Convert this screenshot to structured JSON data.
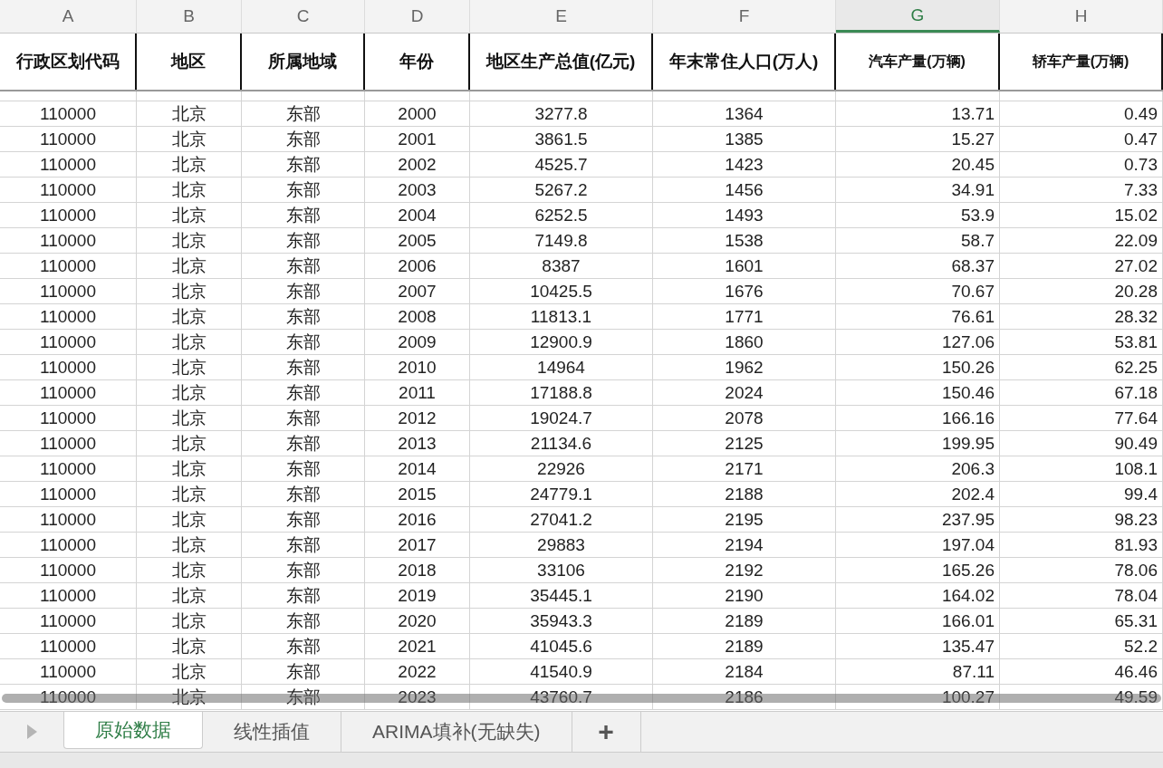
{
  "column_letters": [
    {
      "label": "A",
      "selected": false
    },
    {
      "label": "B",
      "selected": false
    },
    {
      "label": "C",
      "selected": false
    },
    {
      "label": "D",
      "selected": false
    },
    {
      "label": "E",
      "selected": false
    },
    {
      "label": "F",
      "selected": false
    },
    {
      "label": "G",
      "selected": true
    },
    {
      "label": "H",
      "selected": false
    }
  ],
  "table": {
    "columns": [
      "行政区划代码",
      "地区",
      "所属地域",
      "年份",
      "地区生产总值(亿元)",
      "年末常住人口(万人)",
      "汽车产量(万辆)",
      "轿车产量(万辆)"
    ],
    "rows": [
      [
        "110000",
        "北京",
        "东部",
        "2000",
        "3277.8",
        "1364",
        "13.71",
        "0.49"
      ],
      [
        "110000",
        "北京",
        "东部",
        "2001",
        "3861.5",
        "1385",
        "15.27",
        "0.47"
      ],
      [
        "110000",
        "北京",
        "东部",
        "2002",
        "4525.7",
        "1423",
        "20.45",
        "0.73"
      ],
      [
        "110000",
        "北京",
        "东部",
        "2003",
        "5267.2",
        "1456",
        "34.91",
        "7.33"
      ],
      [
        "110000",
        "北京",
        "东部",
        "2004",
        "6252.5",
        "1493",
        "53.9",
        "15.02"
      ],
      [
        "110000",
        "北京",
        "东部",
        "2005",
        "7149.8",
        "1538",
        "58.7",
        "22.09"
      ],
      [
        "110000",
        "北京",
        "东部",
        "2006",
        "8387",
        "1601",
        "68.37",
        "27.02"
      ],
      [
        "110000",
        "北京",
        "东部",
        "2007",
        "10425.5",
        "1676",
        "70.67",
        "20.28"
      ],
      [
        "110000",
        "北京",
        "东部",
        "2008",
        "11813.1",
        "1771",
        "76.61",
        "28.32"
      ],
      [
        "110000",
        "北京",
        "东部",
        "2009",
        "12900.9",
        "1860",
        "127.06",
        "53.81"
      ],
      [
        "110000",
        "北京",
        "东部",
        "2010",
        "14964",
        "1962",
        "150.26",
        "62.25"
      ],
      [
        "110000",
        "北京",
        "东部",
        "2011",
        "17188.8",
        "2024",
        "150.46",
        "67.18"
      ],
      [
        "110000",
        "北京",
        "东部",
        "2012",
        "19024.7",
        "2078",
        "166.16",
        "77.64"
      ],
      [
        "110000",
        "北京",
        "东部",
        "2013",
        "21134.6",
        "2125",
        "199.95",
        "90.49"
      ],
      [
        "110000",
        "北京",
        "东部",
        "2014",
        "22926",
        "2171",
        "206.3",
        "108.1"
      ],
      [
        "110000",
        "北京",
        "东部",
        "2015",
        "24779.1",
        "2188",
        "202.4",
        "99.4"
      ],
      [
        "110000",
        "北京",
        "东部",
        "2016",
        "27041.2",
        "2195",
        "237.95",
        "98.23"
      ],
      [
        "110000",
        "北京",
        "东部",
        "2017",
        "29883",
        "2194",
        "197.04",
        "81.93"
      ],
      [
        "110000",
        "北京",
        "东部",
        "2018",
        "33106",
        "2192",
        "165.26",
        "78.06"
      ],
      [
        "110000",
        "北京",
        "东部",
        "2019",
        "35445.1",
        "2190",
        "164.02",
        "78.04"
      ],
      [
        "110000",
        "北京",
        "东部",
        "2020",
        "35943.3",
        "2189",
        "166.01",
        "65.31"
      ],
      [
        "110000",
        "北京",
        "东部",
        "2021",
        "41045.6",
        "2189",
        "135.47",
        "52.2"
      ],
      [
        "110000",
        "北京",
        "东部",
        "2022",
        "41540.9",
        "2184",
        "87.11",
        "46.46"
      ],
      [
        "110000",
        "北京",
        "东部",
        "2023",
        "43760.7",
        "2186",
        "100.27",
        "49.59"
      ]
    ]
  },
  "sheet_tabs": [
    {
      "label": "原始数据",
      "selected": true
    },
    {
      "label": "线性插值",
      "selected": false
    },
    {
      "label": "ARIMA填补(无缺失)",
      "selected": false
    }
  ],
  "add_sheet": "+"
}
